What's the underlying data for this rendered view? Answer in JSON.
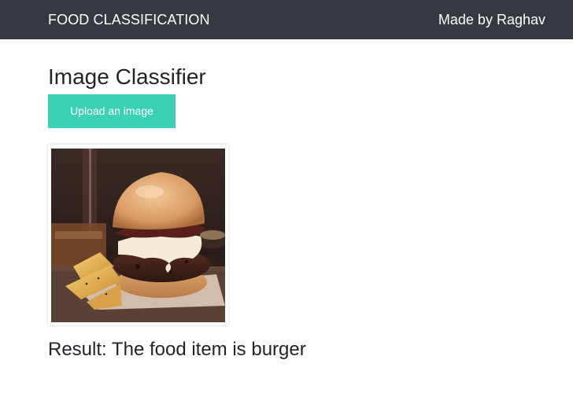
{
  "navbar": {
    "brand": "FOOD CLASSIFICATION",
    "credit": "Made by Raghav"
  },
  "main": {
    "title": "Image Classifier",
    "upload_label": "Upload an image",
    "result": "Result: The food item is burger"
  },
  "colors": {
    "navbar_bg": "#343a40",
    "accent": "#3ad1b5"
  }
}
